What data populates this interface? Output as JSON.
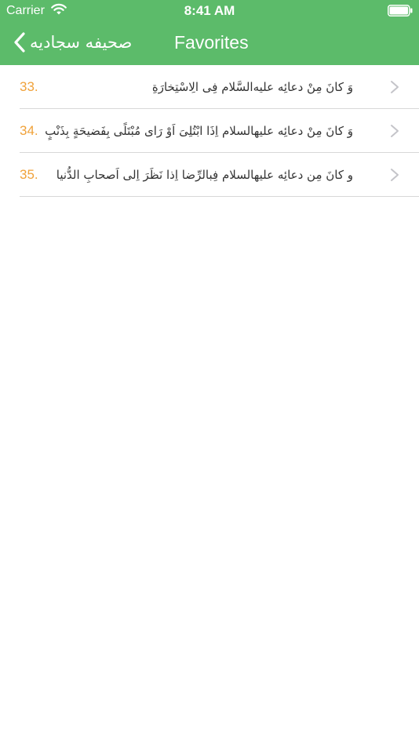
{
  "status_bar": {
    "carrier": "Carrier",
    "time": "8:41 AM",
    "wifi_icon": "wifi-icon",
    "battery_icon": "battery-icon"
  },
  "nav": {
    "back_label": "صحیفه سجادیه",
    "back_icon": "chevron-left-icon",
    "title": "Favorites",
    "background_color": "#5cbb6a"
  },
  "favorites": [
    {
      "number": "33.",
      "title": "وَ كانَ مِنْ دعائِه علیه‌السَّلام فِی الِاسْتِخارَةِ"
    },
    {
      "number": "34.",
      "title": "وَ كانَ مِنْ دعائِه علیهالسلام اِذَا ابْتُلِیَ اَوْ رَای مُبْتَلًی بِفَضیحَةٍ بِذَنْبٍ"
    },
    {
      "number": "35.",
      "title": "و كانَ مِن دعائِه علیهالسلام فِبالرِّضا اِذا نَظَرَ اِلی اَصحابِ الدُّنیا"
    }
  ],
  "colors": {
    "accent": "#5cbb6a",
    "number": "#f0a23a",
    "separator": "#d8d8d8"
  }
}
